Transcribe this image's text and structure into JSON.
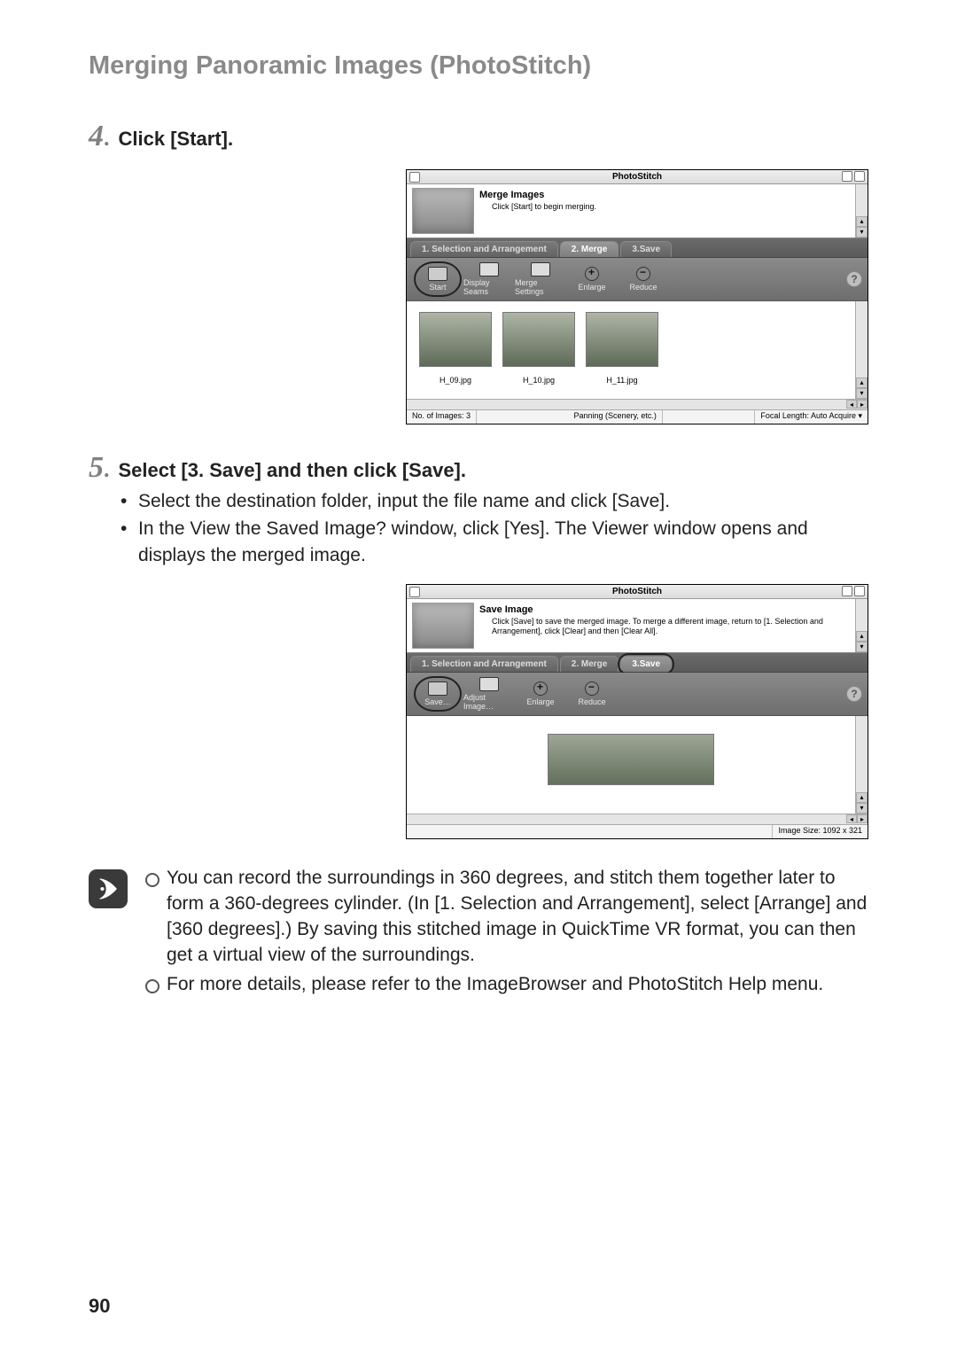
{
  "section_title": "Merging Panoramic Images (PhotoStitch)",
  "page_number": "90",
  "step4": {
    "num": "4",
    "title": "Click [Start]."
  },
  "app_merge": {
    "app_title": "PhotoStitch",
    "header": {
      "heading": "Merge Images",
      "sub": "Click [Start] to begin merging."
    },
    "tabs": {
      "t1": "1. Selection and Arrangement",
      "t2": "2. Merge",
      "t3": "3.Save"
    },
    "toolbar": {
      "start": "Start",
      "display": "Display Seams",
      "merge_settings": "Merge Settings",
      "enlarge": "Enlarge",
      "reduce": "Reduce",
      "help": "?"
    },
    "thumbs": {
      "a": "H_09.jpg",
      "b": "H_10.jpg",
      "c": "H_11.jpg"
    },
    "status": {
      "left": "No. of Images: 3",
      "mid": "Panning (Scenery, etc.)",
      "right": "Focal Length: Auto Acquire ▾"
    }
  },
  "step5": {
    "num": "5",
    "title": "Select [3. Save] and then click [Save].",
    "b1": "Select the destination folder, input the file name and click [Save].",
    "b2": "In the View the Saved Image? window, click [Yes]. The Viewer window opens and displays the merged image."
  },
  "app_save": {
    "app_title": "PhotoStitch",
    "header": {
      "heading": "Save Image",
      "sub": "Click [Save] to save the merged image. To merge a different image, return to [1. Selection and Arrangement], click [Clear] and then [Clear All]."
    },
    "tabs": {
      "t1": "1. Selection and Arrangement",
      "t2": "2. Merge",
      "t3": "3.Save"
    },
    "toolbar": {
      "save": "Save…",
      "adjust": "Adjust Image…",
      "enlarge": "Enlarge",
      "reduce": "Reduce",
      "help": "?"
    },
    "status": {
      "right": "Image Size: 1092 x 321"
    }
  },
  "notes": {
    "n1": "You can record the surroundings in 360 degrees, and stitch them together later to form a 360-degrees cylinder. (In [1. Selection and Arrangement], select [Arrange] and [360 degrees].) By saving this stitched image in QuickTime VR format, you can then get a virtual view of the surroundings.",
    "n2": "For more details, please refer to the ImageBrowser and PhotoStitch Help menu."
  }
}
